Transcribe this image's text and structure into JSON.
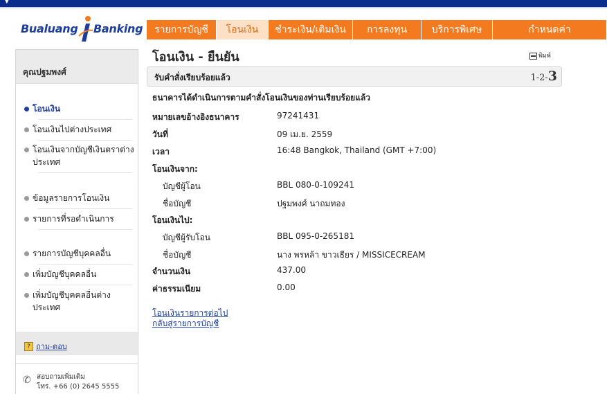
{
  "colors": {
    "brand_blue": "#1d3e9c",
    "nav_orange": "#f47a1f",
    "nav_active_bg": "#fde0c6",
    "topbar": "#0b2d8c"
  },
  "logo": {
    "part1": "Bualuang",
    "part2": "Banking"
  },
  "nav": {
    "tabs": [
      {
        "label": "รายการบัญชี",
        "active": false
      },
      {
        "label": "โอนเงิน",
        "active": true
      },
      {
        "label": "ชำระเงิน/เติมเงิน",
        "active": false
      },
      {
        "label": "การลงทุน",
        "active": false
      },
      {
        "label": "บริการพิเศษ",
        "active": false
      },
      {
        "label": "กำหนดค่า",
        "active": false
      }
    ]
  },
  "sidebar": {
    "user_name": "คุณปฐมพงศ์",
    "items": [
      {
        "label": "โอนเงิน",
        "active": true
      },
      {
        "label": "โอนเงินไปต่างประเทศ",
        "active": false
      },
      {
        "label": "โอนเงินจากบัญชีเงินตราต่างประเทศ",
        "active": false
      },
      {
        "label": "ข้อมูลรายการโอนเงิน",
        "active": false
      },
      {
        "label": "รายการที่รอดำเนินการ",
        "active": false
      },
      {
        "label": "รายการบัญชีบุคคลอื่น",
        "active": false
      },
      {
        "label": "เพิ่มบัญชีบุคคลอื่น",
        "active": false
      },
      {
        "label": "เพิ่มบัญชีบุคคลอื่นต่างประเทศ",
        "active": false
      }
    ],
    "qa": {
      "icon_label": "?",
      "label": "ถาม-ตอบ"
    },
    "contact": {
      "line1": "สอบถามเพิ่มเติม",
      "line2": "โทร. +66 (0) 2645 5555"
    }
  },
  "main": {
    "title": "โอนเงิน - ยืนยัน",
    "print_label": "พิมพ์",
    "step_text": "รับคำสั่งเรียบร้อยแล้ว",
    "steps_prefix": "1-2-",
    "steps_current": "3",
    "confirm_message": "ธนาคารได้ดำเนินการตามคำสั่งโอนเงินของท่านเรียบร้อยแล้ว",
    "fields": {
      "ref_label": "หมายเลขอ้างอิงธนาคาร",
      "ref_value": "97241431",
      "date_label": "วันที่",
      "date_value": "09 เม.ย. 2559",
      "time_label": "เวลา",
      "time_value": "16:48 Bangkok, Thailand (GMT +7:00)",
      "from_label": "โอนเงินจาก:",
      "from_account_label": "บัญชีผู้โอน",
      "from_account_value": "BBL 080-0-109241",
      "from_name_label": "ชื่อบัญชี",
      "from_name_value": "ปฐมพงศ์ นาถมทอง",
      "to_label": "โอนเงินไป:",
      "to_account_label": "บัญชีผู้รับโอน",
      "to_account_value": "BBL 095-0-265181",
      "to_name_label": "ชื่อบัญชี",
      "to_name_value": "นาง พรหล้า ขาวเธียร / MISSICECREAM",
      "amount_label": "จำนวนเงิน",
      "amount_value": "437.00",
      "fee_label": "ค่าธรรมเนียม",
      "fee_value": "0.00"
    },
    "links": {
      "transfer_next": "โอนเงินรายการต่อไป",
      "back_accounts": "กลับสู่รายการบัญชี"
    }
  }
}
